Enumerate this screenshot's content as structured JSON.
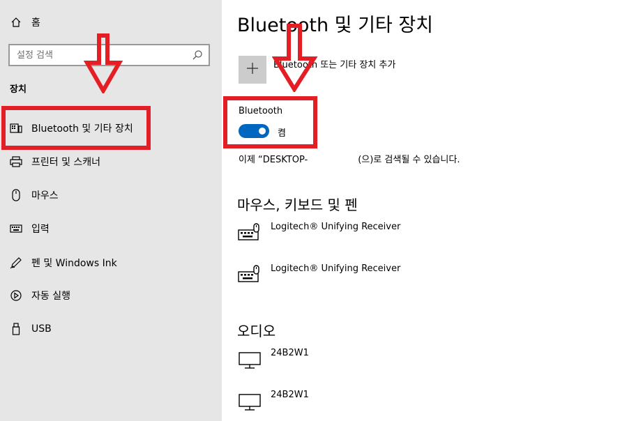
{
  "sidebar": {
    "home_label": "홈",
    "search_placeholder": "설정 검색",
    "section_label": "장치",
    "items": [
      {
        "label": "Bluetooth 및 기타 장치",
        "icon": "bluetooth-devices-icon"
      },
      {
        "label": "프린터 및 스캐너",
        "icon": "printer-icon"
      },
      {
        "label": "마우스",
        "icon": "mouse-icon"
      },
      {
        "label": "입력",
        "icon": "keyboard-icon"
      },
      {
        "label": "펜 및 Windows Ink",
        "icon": "pen-icon"
      },
      {
        "label": "자동 실행",
        "icon": "autoplay-icon"
      },
      {
        "label": "USB",
        "icon": "usb-icon"
      }
    ]
  },
  "main": {
    "title": "Bluetooth 및 기타 장치",
    "add_device_label": "Bluetooth 또는 기타 장치 추가",
    "bluetooth_label": "Bluetooth",
    "toggle_state": "켬",
    "discover_prefix": "이제 “DESKTOP-",
    "discover_suffix": "(으)로 검색될 수 있습니다.",
    "sections": [
      {
        "heading": "마우스, 키보드 및 펜",
        "devices": [
          {
            "name": "Logitech® Unifying Receiver",
            "icon": "keyboard-mouse-icon"
          },
          {
            "name": "Logitech® Unifying Receiver",
            "icon": "keyboard-mouse-icon"
          }
        ]
      },
      {
        "heading": "오디오",
        "devices": [
          {
            "name": "24B2W1",
            "icon": "monitor-icon"
          },
          {
            "name": "24B2W1",
            "icon": "monitor-icon"
          }
        ]
      }
    ]
  },
  "colors": {
    "sidebar_bg": "#e6e6e6",
    "toggle_on": "#0067c0",
    "add_button_bg": "#cccccc",
    "annotation_red": "#e31e24"
  }
}
